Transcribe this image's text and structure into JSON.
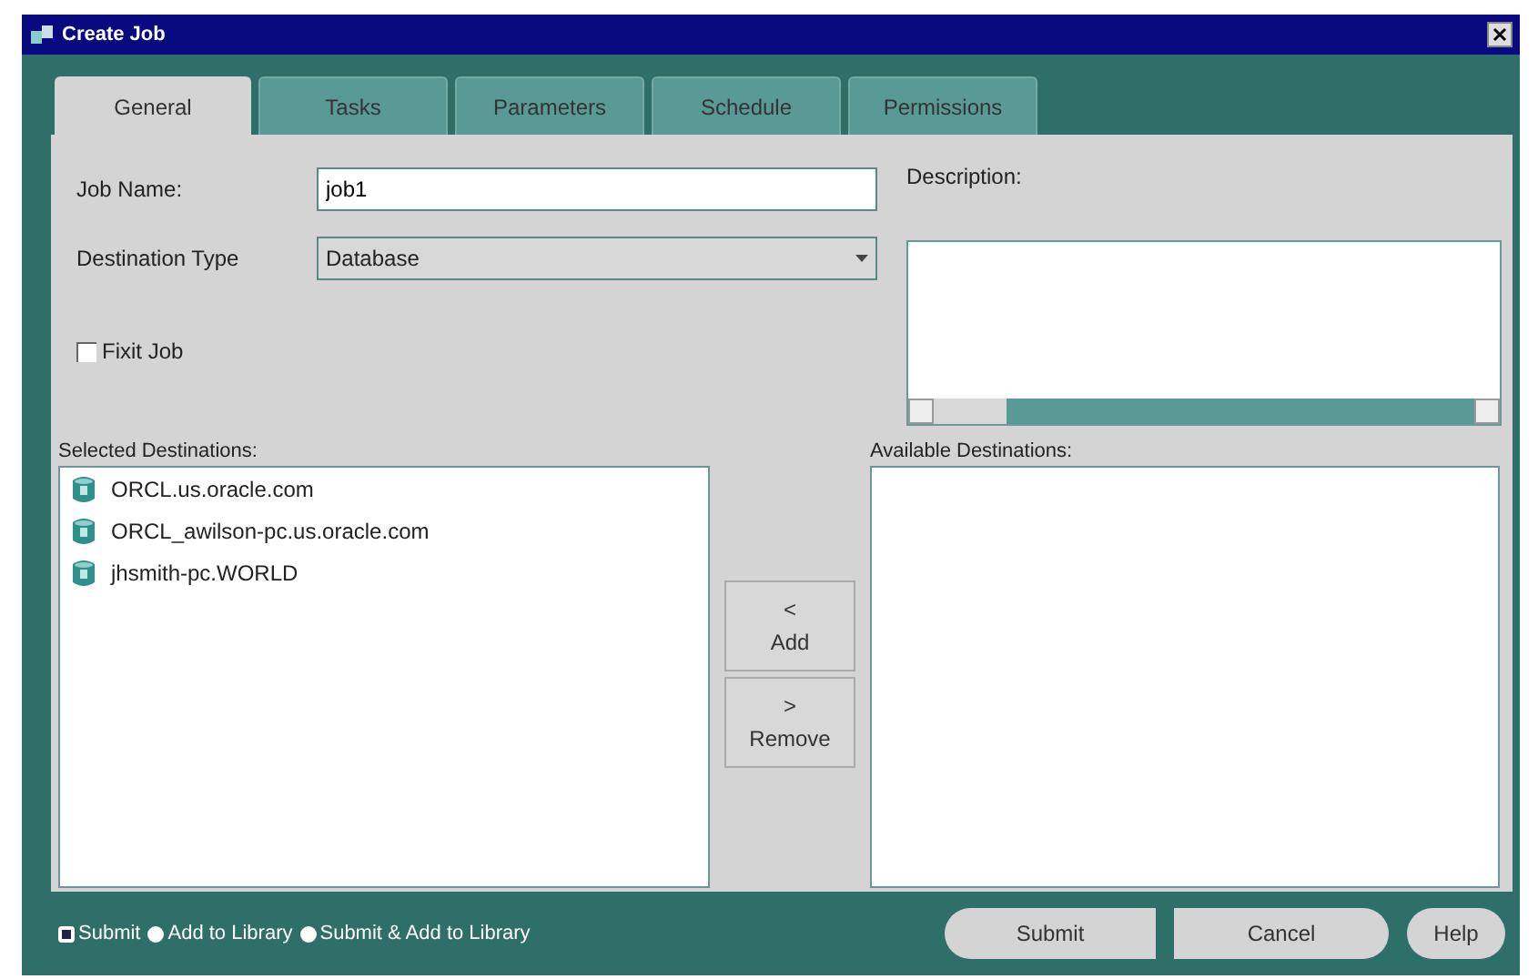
{
  "window": {
    "title": "Create Job"
  },
  "tabs": [
    {
      "label": "General",
      "selected": true
    },
    {
      "label": "Tasks",
      "selected": false
    },
    {
      "label": "Parameters",
      "selected": false
    },
    {
      "label": "Schedule",
      "selected": false
    },
    {
      "label": "Permissions",
      "selected": false
    }
  ],
  "job_name": {
    "label": "Job Name:",
    "value": "job1"
  },
  "destination_type": {
    "label": "Destination Type",
    "value": "Database"
  },
  "fixit_job": {
    "label": "Fixit Job",
    "checked": false
  },
  "description": {
    "label": "Description:"
  },
  "selected_destinations": {
    "label": "Selected Destinations:",
    "items": [
      "ORCL.us.oracle.com",
      "ORCL_awilson-pc.us.oracle.com",
      "jhsmith-pc.WORLD"
    ]
  },
  "available_destinations": {
    "label": "Available Destinations:"
  },
  "move_buttons": [
    {
      "arrow": "<",
      "label": "Add"
    },
    {
      "arrow": ">",
      "label": "Remove"
    }
  ],
  "submit_options": [
    {
      "label": "Submit",
      "selected": true
    },
    {
      "label": "Add to Library",
      "selected": false
    },
    {
      "label": "Submit & Add to Library",
      "selected": false
    }
  ],
  "buttons": [
    {
      "label": "Submit",
      "kind": "left"
    },
    {
      "label": "Cancel",
      "kind": "right"
    },
    {
      "label": "Help",
      "kind": "pill"
    }
  ]
}
